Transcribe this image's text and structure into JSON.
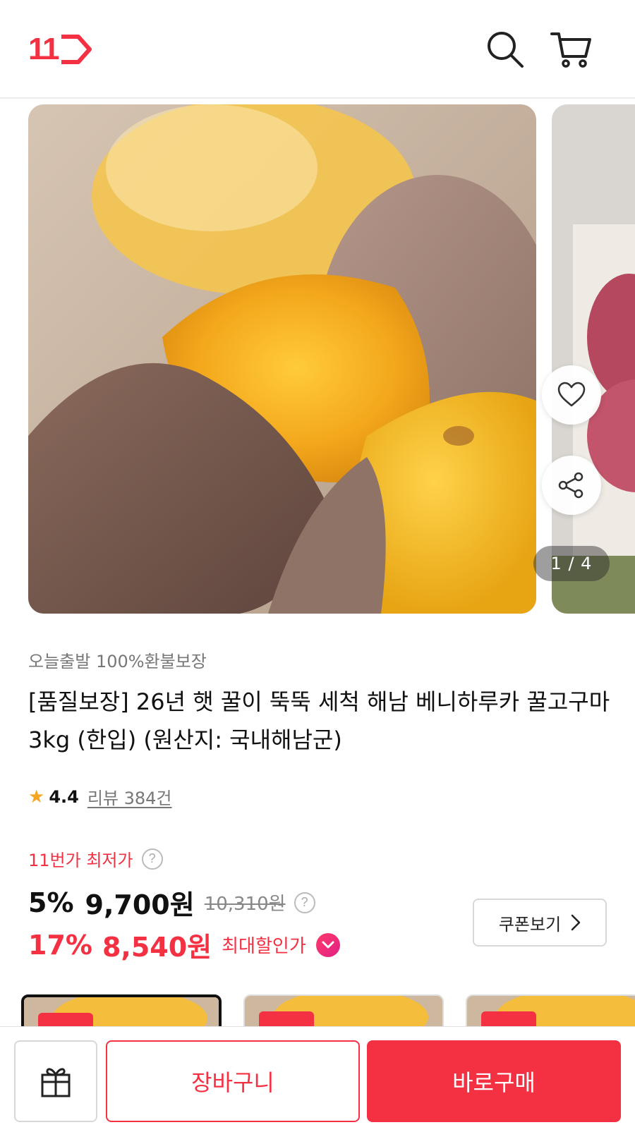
{
  "header": {
    "logo_text": "11",
    "search_icon": "search-icon",
    "cart_icon": "cart-icon"
  },
  "gallery": {
    "counter": "1 / 4",
    "current": 1,
    "total": 4
  },
  "product": {
    "tag_line": "오늘출발 100%환불보장",
    "title": "[품질보장] 26년 햇 꿀이 뚝뚝 세척 해남 베니하루카 꿀고구마 3kg (한입) (원산지: 국내해남군)",
    "rating": "4.4",
    "review_link": "리뷰 384건"
  },
  "price": {
    "lowest_label": "11번가 최저가",
    "discount": "5%",
    "sale_price": "9,700원",
    "original_price": "10,310원",
    "max_discount": "17%",
    "max_price": "8,540원",
    "max_label": "최대할인가",
    "coupon_button": "쿠폰보기"
  },
  "bottom_bar": {
    "cart_label": "장바구니",
    "buy_label": "바로구매"
  },
  "colors": {
    "brand": "#f43142",
    "star": "#f5a623"
  }
}
